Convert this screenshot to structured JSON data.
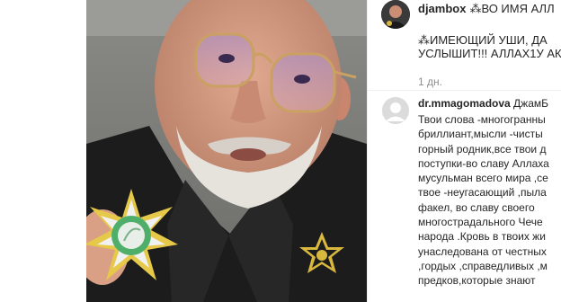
{
  "post": {
    "username": "djambox",
    "caption_head": "⁂ВО ИМЯ АЛЛ",
    "caption_lines": [
      "⁂ИМЕЮЩИЙ УШИ, ДА",
      "УСЛЫШИТ!!! АЛЛАХ1У АК"
    ],
    "time": "1 дн."
  },
  "comment": {
    "username": "dr.mmagomadova",
    "first_word": "ДжамБ",
    "lines": [
      "Твои слова -многогранны",
      "бриллиант,мысли -чисты",
      "горный родник,все твои д",
      "поступки-во славу Аллаха",
      "мусульман всего мира ,се",
      "твое -неугасающий ,пыла",
      "факел, во славу своего",
      "многострадального Чече",
      "народа .Кровь в твоих жи",
      "унаследована от честных",
      ",гордых ,справедливых ,м",
      "предков,которые знают"
    ]
  },
  "colors": {
    "text": "#262626",
    "muted": "#8e8e8e",
    "divider": "#efefef"
  },
  "icons": {
    "post_avatar": "profile-photo",
    "comment_avatar": "default-user-icon"
  }
}
